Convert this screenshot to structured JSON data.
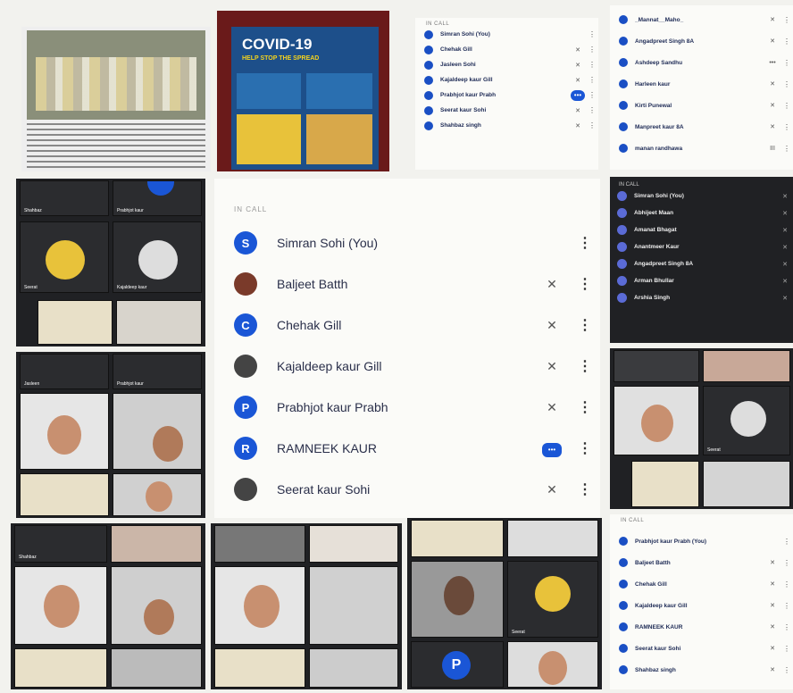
{
  "tile_people_top": {
    "header": "IN CALL",
    "rows": [
      {
        "name": "Simran Sohi (You)",
        "mic": "",
        "speaking": false
      },
      {
        "name": "Chehak Gill",
        "mic": "✕",
        "speaking": false
      },
      {
        "name": "Jasleen Sohi",
        "mic": "✕",
        "speaking": false
      },
      {
        "name": "Kajaldeep kaur Gill",
        "mic": "✕",
        "speaking": false
      },
      {
        "name": "Prabhjot kaur Prabh",
        "mic": "",
        "speaking": true
      },
      {
        "name": "Seerat kaur Sohi",
        "mic": "✕",
        "speaking": false
      },
      {
        "name": "Shahbaz singh",
        "mic": "✕",
        "speaking": false
      }
    ]
  },
  "tile_people_topright": {
    "rows": [
      {
        "name": "_Mannat__Maho_",
        "mic": "✕"
      },
      {
        "name": "Angadpreet Singh 8A",
        "mic": "✕"
      },
      {
        "name": "Ashdeep Sandhu",
        "mic": "•••"
      },
      {
        "name": "Harleen kaur",
        "mic": "✕"
      },
      {
        "name": "Kirti Punewal",
        "mic": "✕"
      },
      {
        "name": "Manpreet kaur 8A",
        "mic": "✕"
      },
      {
        "name": "manan randhawa",
        "mic": "III"
      }
    ]
  },
  "poster": {
    "title": "COVID-19",
    "subtitle": "HELP STOP THE SPREAD"
  },
  "big_panel": {
    "header": "IN CALL",
    "rows": [
      {
        "initial": "S",
        "name": "Simran Sohi (You)",
        "mic": "",
        "speaking": false,
        "avatar": "letter"
      },
      {
        "initial": "",
        "name": "Baljeet Batth",
        "mic": "✕",
        "speaking": false,
        "avatar": "photo"
      },
      {
        "initial": "C",
        "name": "Chehak Gill",
        "mic": "✕",
        "speaking": false,
        "avatar": "letter"
      },
      {
        "initial": "",
        "name": "Kajaldeep kaur Gill",
        "mic": "✕",
        "speaking": false,
        "avatar": "photo2"
      },
      {
        "initial": "P",
        "name": "Prabhjot kaur Prabh",
        "mic": "✕",
        "speaking": false,
        "avatar": "letter"
      },
      {
        "initial": "R",
        "name": "RAMNEEK KAUR",
        "mic": "",
        "speaking": true,
        "avatar": "letter"
      },
      {
        "initial": "",
        "name": "Seerat kaur Sohi",
        "mic": "✕",
        "speaking": false,
        "avatar": "photo2"
      }
    ]
  },
  "dark_panel": {
    "header": "IN CALL",
    "rows": [
      {
        "name": "Simran Sohi (You)"
      },
      {
        "name": "Abhijeet Maan"
      },
      {
        "name": "Amanat Bhagat"
      },
      {
        "name": "Anantmeer Kaur"
      },
      {
        "name": "Angadpreet Singh 8A"
      },
      {
        "name": "Arman Bhullar"
      },
      {
        "name": "Arshia Singh"
      }
    ]
  },
  "people_bottomright": {
    "header": "IN CALL",
    "rows": [
      {
        "name": "Prabhjot kaur Prabh (You)",
        "mic": ""
      },
      {
        "name": "Baljeet Batth",
        "mic": "✕"
      },
      {
        "name": "Chehak Gill",
        "mic": "✕"
      },
      {
        "name": "Kajaldeep kaur Gill",
        "mic": "✕"
      },
      {
        "name": "RAMNEEK KAUR",
        "mic": "✕"
      },
      {
        "name": "Seerat kaur Sohi",
        "mic": "✕"
      },
      {
        "name": "Shahbaz singh",
        "mic": "✕"
      }
    ]
  },
  "video_labels": {
    "shahbaz": "Shahbaz",
    "prabhjot": "Prabhjot kaur",
    "seerat": "Seerat",
    "kajal": "Kajaldeep kaur",
    "jasleen": "Jasleen"
  },
  "colors": {
    "accent": "#1a56d6",
    "meet_dark": "#202124"
  }
}
